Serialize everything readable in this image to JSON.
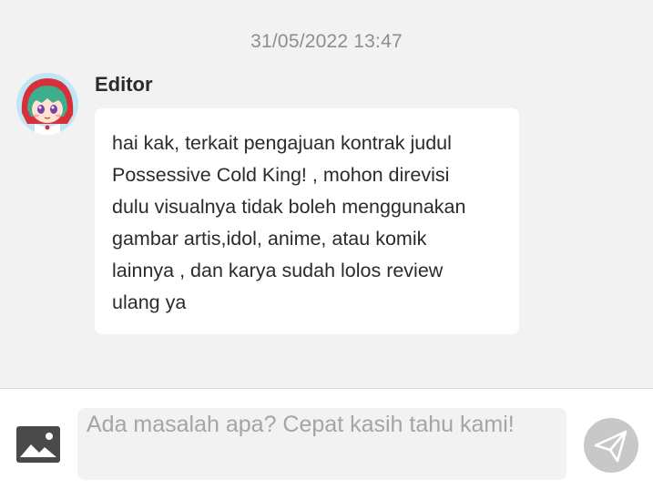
{
  "chat": {
    "timestamp": "31/05/2022 13:47",
    "messages": [
      {
        "sender": "Editor",
        "avatar_icon": "anime-girl-avatar",
        "text": "hai kak, terkait pengajuan kontrak judul\nPossessive Cold King! , mohon direvisi\ndulu visualnya tidak boleh menggunakan\ngambar artis,idol, anime, atau komik\nlainnya , dan karya sudah lolos review\nulang ya"
      }
    ]
  },
  "composer": {
    "placeholder": "Ada masalah apa? Cepat kasih tahu kami!",
    "value": "",
    "image_icon": "image-icon",
    "send_icon": "send-icon"
  },
  "colors": {
    "background": "#f2f2f2",
    "bubble": "#ffffff",
    "send_button": "#c8c8c8",
    "image_icon": "#4a4a4a"
  }
}
